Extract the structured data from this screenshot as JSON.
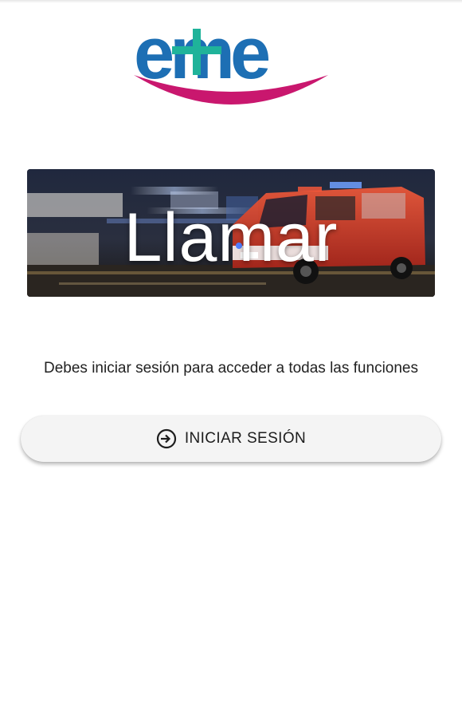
{
  "logo": {
    "text": "eme",
    "icon": "eme-logo",
    "colors": {
      "primary": "#1d6fb4",
      "cross": "#1fb39a",
      "smile": "#c9176e"
    }
  },
  "banner": {
    "title": "Llamar",
    "image": "ambulance-night-photo"
  },
  "login": {
    "message": "Debes iniciar sesión para acceder a todas las funciones",
    "button_label": "INICIAR SESIÓN",
    "button_icon": "login-icon"
  }
}
